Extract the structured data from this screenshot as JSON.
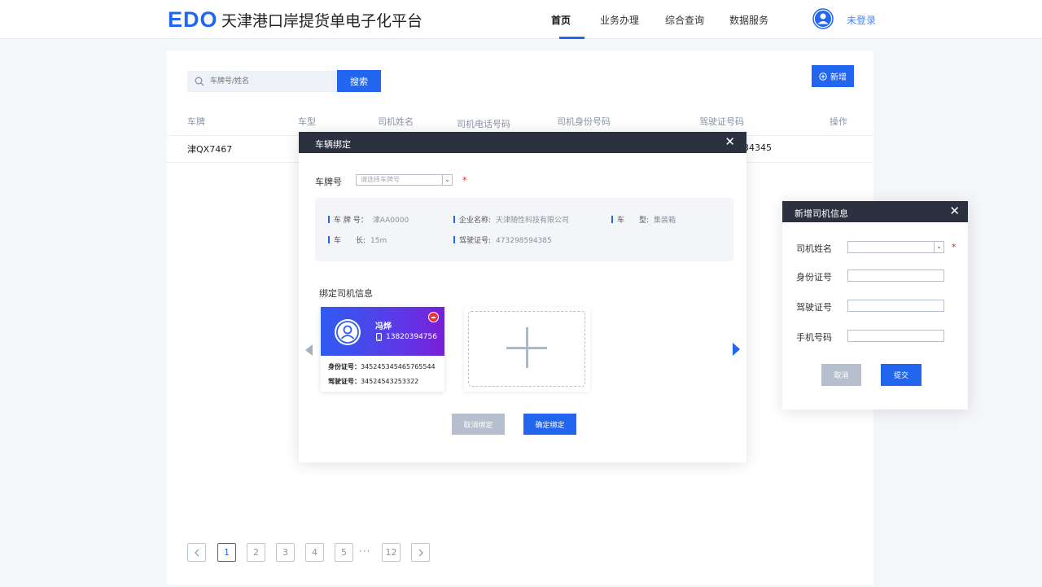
{
  "header": {
    "logo": "EDO",
    "site_title": "天津港口岸提货单电子化平台",
    "nav": [
      "首页",
      "业务办理",
      "综合查询",
      "数据服务"
    ],
    "login_label": "未登录"
  },
  "toolbar": {
    "search_placeholder": "车牌号/姓名",
    "search_label": "搜索",
    "add_label": "新增"
  },
  "table": {
    "columns": [
      "车牌",
      "车型",
      "司机姓名",
      "司机电话号码",
      "司机身份号码",
      "驾驶证号码",
      "操作"
    ],
    "rows": [
      {
        "plate": "津QX7467",
        "license_tail": "34345"
      }
    ]
  },
  "pagination": {
    "pages": [
      "1",
      "2",
      "3",
      "4",
      "5"
    ],
    "ellipsis": "···",
    "last": "12",
    "current": 1
  },
  "bind_dialog": {
    "title": "车辆绑定",
    "close": "✕",
    "plate_label": "车牌号",
    "plate_placeholder": "请选择车牌号",
    "required": "*",
    "info": {
      "plate_label": "车 牌 号：",
      "plate_value": "津AA0000",
      "company_label": "企业名称:",
      "company_value": "天津随性科技有限公司",
      "type_label": "车　　型:",
      "type_value": "集装箱",
      "length_label": "车　　长:",
      "length_value": "15m",
      "license_label": "驾驶证号:",
      "license_value": "473298594385"
    },
    "drivers_title": "绑定司机信息",
    "driver": {
      "name": "冯烨",
      "phone": "13820394756",
      "id_label": "身份证号：",
      "id_value": "345245345465765544",
      "license_label": "驾驶证号：",
      "license_value": "34524543253322"
    },
    "cancel_label": "取消绑定",
    "confirm_label": "确定绑定"
  },
  "driver_dialog": {
    "title": "新增司机信息",
    "close": "✕",
    "name_label": "司机姓名",
    "id_label": "身份证号",
    "license_label": "驾驶证号",
    "phone_label": "手机号码",
    "required": "*",
    "cancel_label": "取消",
    "submit_label": "提交"
  },
  "colors": {
    "primary": "#2266f0",
    "dialog_header": "#2c3140",
    "disabled": "#b6bfcd",
    "required": "#e02020"
  }
}
